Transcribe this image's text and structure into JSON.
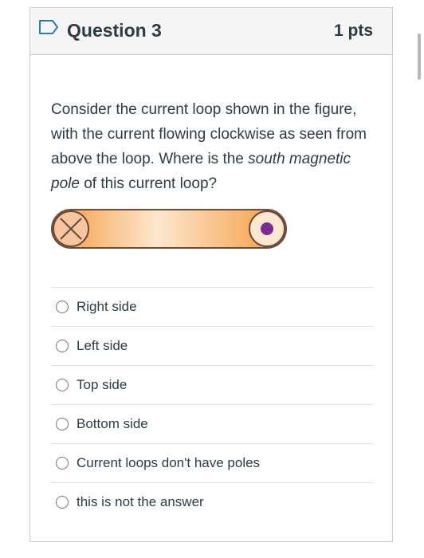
{
  "question": {
    "title": "Question 3",
    "points": "1 pts",
    "text_part1": "Consider the current loop shown in the figure, with the current flowing clockwise as seen from above the loop. Where is the ",
    "text_emphasis": "south magnetic pole",
    "text_part2": " of this current loop?"
  },
  "figure": {
    "colors": {
      "band_edge": "#f59a3c",
      "band_center": "#fde7cf",
      "outline": "#6b4a3a",
      "dot": "#7a2c8f"
    },
    "left_symbol": "cross (current into page)",
    "right_symbol": "dot (current out of page)"
  },
  "answers": [
    {
      "label": "Right side"
    },
    {
      "label": "Left side"
    },
    {
      "label": "Top side"
    },
    {
      "label": "Bottom side"
    },
    {
      "label": "Current loops don't have poles"
    },
    {
      "label": "this is not the answer"
    }
  ]
}
